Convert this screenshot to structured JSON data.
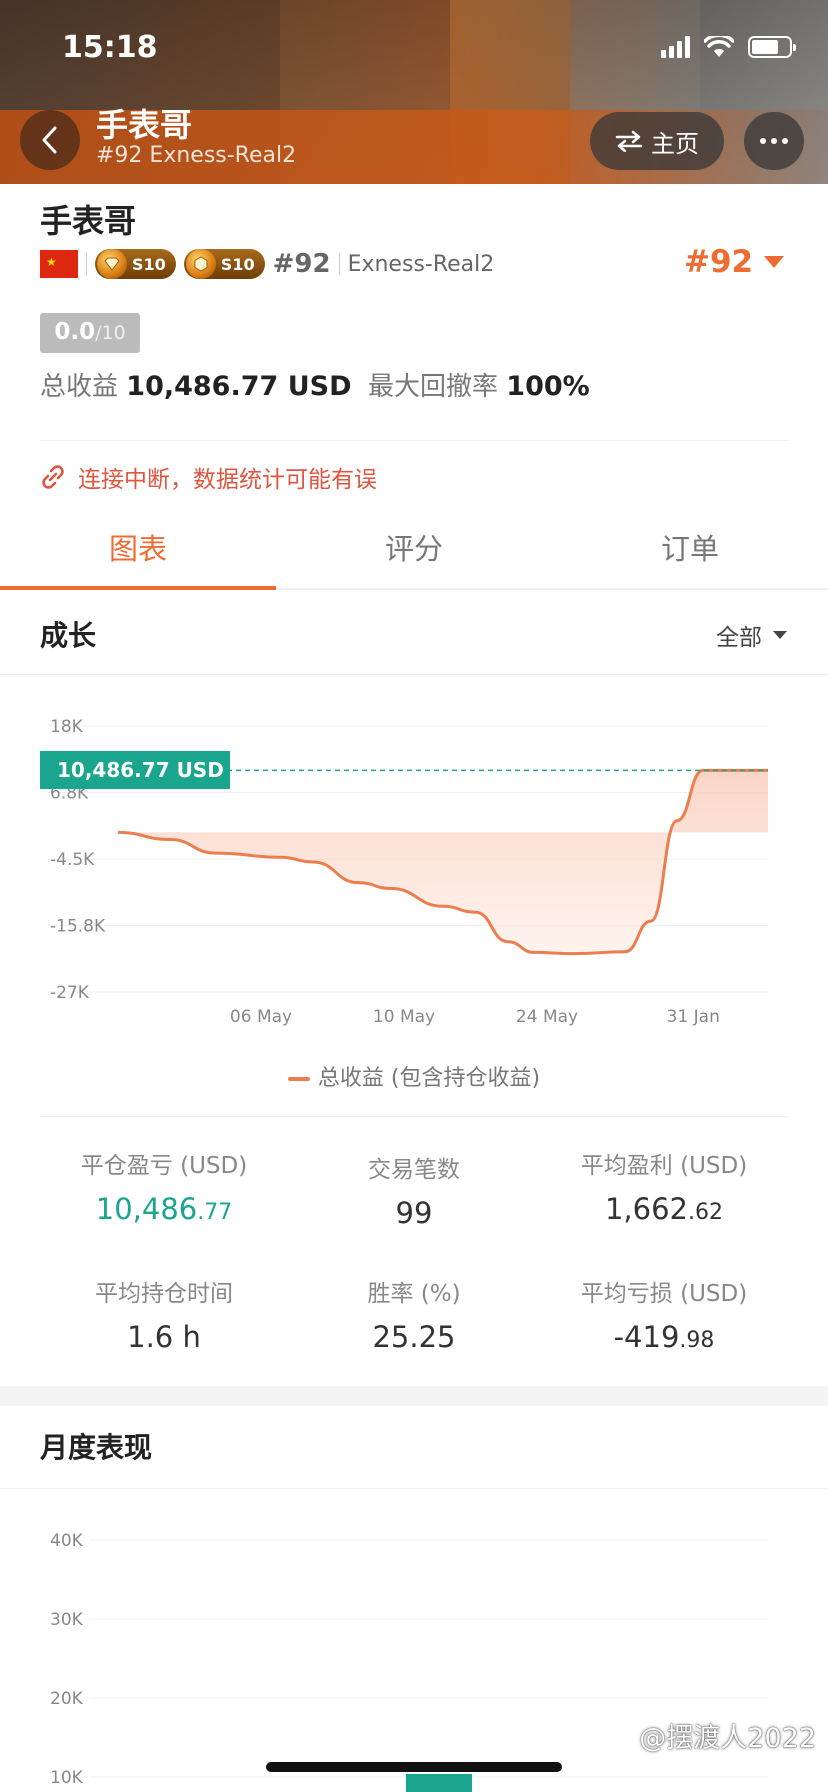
{
  "status_bar": {
    "time": "15:18"
  },
  "header": {
    "name": "手表哥",
    "subtitle": "#92 Exness-Real2",
    "home_label": "主页"
  },
  "profile": {
    "name": "手表哥",
    "badges": [
      "S10",
      "S10"
    ],
    "rank": "#92",
    "server": "Exness-Real2",
    "rank_right": "#92",
    "score_value": "0.0",
    "score_denominator": "/10",
    "total_profit_label": "总收益",
    "total_profit_value": "10,486.77 USD",
    "max_drawdown_label": "最大回撤率",
    "max_drawdown_value": "100%",
    "warning": "连接中断，数据统计可能有误"
  },
  "tabs": [
    {
      "label": "图表",
      "active": true
    },
    {
      "label": "评分",
      "active": false
    },
    {
      "label": "订单",
      "active": false
    }
  ],
  "growth": {
    "title": "成长",
    "range_label": "全部",
    "value_tag": "10,486.77 USD",
    "legend": "总收益 (包含持仓收益)"
  },
  "chart_data": [
    {
      "type": "area",
      "y_ticks": [
        "18K",
        "6.8K",
        "-4.5K",
        "-15.8K",
        "-27K"
      ],
      "x_ticks": [
        "06 May",
        "10 May",
        "24 May",
        "31 Jan"
      ],
      "series": [
        {
          "name": "总收益 (包含持仓收益)",
          "x": [
            0,
            0.08,
            0.15,
            0.25,
            0.3,
            0.37,
            0.42,
            0.5,
            0.55,
            0.6,
            0.64,
            0.7,
            0.78,
            0.82,
            0.86,
            0.9,
            0.94,
            1.0
          ],
          "values": [
            0,
            -1200,
            -3500,
            -4200,
            -5000,
            -8500,
            -9500,
            -12500,
            -13500,
            -18500,
            -20300,
            -20500,
            -20200,
            -15000,
            2000,
            10486.77,
            10486.77,
            10486.77
          ]
        }
      ],
      "ylim": [
        -27000,
        18000
      ],
      "reference_line": 10486.77,
      "color": "#ec7d4e",
      "ref_color": "#1aa58e"
    },
    {
      "type": "bar",
      "title": "月度表现",
      "y_ticks": [
        "40K",
        "30K",
        "20K",
        "10K"
      ],
      "ylim": [
        0,
        45000
      ],
      "color": "#1aa58e"
    }
  ],
  "stats": [
    {
      "label": "平仓盈亏 (USD)",
      "value_main": "10,486",
      "value_small": ".77",
      "highlight": true
    },
    {
      "label": "交易笔数",
      "value_main": "99",
      "value_small": "",
      "highlight": false
    },
    {
      "label": "平均盈利 (USD)",
      "value_main": "1,662",
      "value_small": ".62",
      "highlight": false
    },
    {
      "label": "平均持仓时间",
      "value_main": "1.6 h",
      "value_small": "",
      "highlight": false
    },
    {
      "label": "胜率 (%)",
      "value_main": "25.25",
      "value_small": "",
      "highlight": false
    },
    {
      "label": "平均亏损 (USD)",
      "value_main": "-419",
      "value_small": ".98",
      "highlight": false
    }
  ],
  "monthly": {
    "title": "月度表现"
  },
  "watermark": "@摆渡人2022"
}
